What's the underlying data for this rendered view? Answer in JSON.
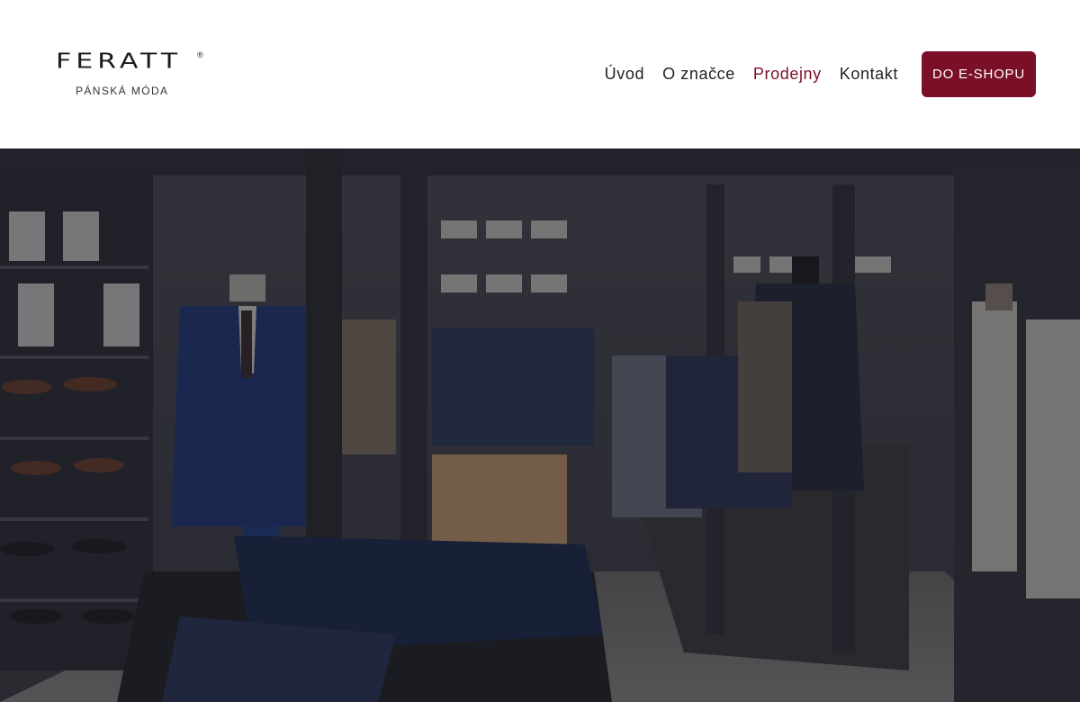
{
  "header": {
    "logo": {
      "wordmark": "FERATT",
      "registered": "®",
      "tagline": "PÁNSKÁ MÓDA"
    },
    "nav": [
      {
        "label": "Úvod",
        "active": false
      },
      {
        "label": "O značce",
        "active": false
      },
      {
        "label": "Prodejny",
        "active": true
      },
      {
        "label": "Kontakt",
        "active": false
      }
    ],
    "cta_label": "DO E-SHOPU"
  },
  "colors": {
    "accent": "#7a0f28",
    "text": "#222222",
    "background": "#ffffff"
  },
  "hero": {
    "image_alt": "store-interior-photo"
  }
}
